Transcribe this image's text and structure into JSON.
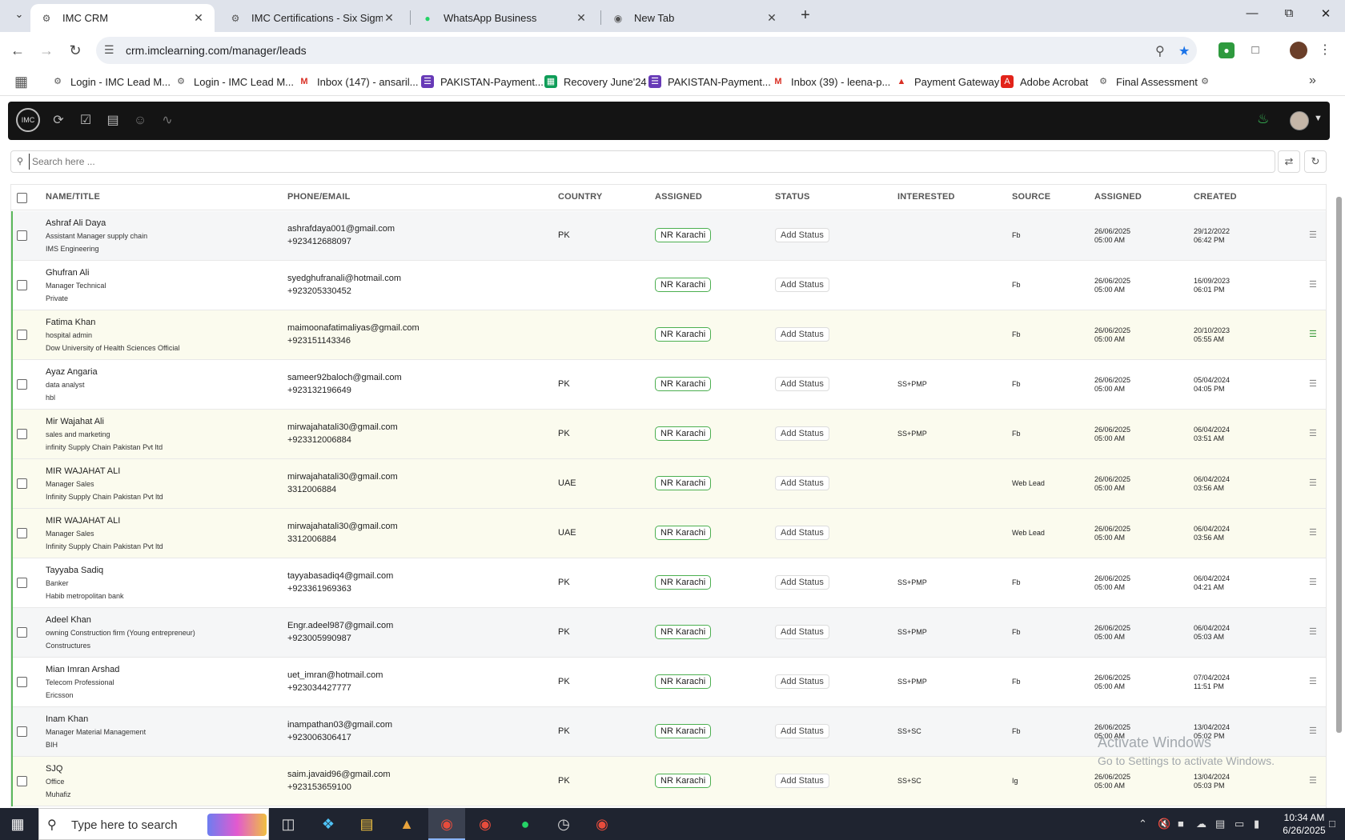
{
  "browser": {
    "tabs": [
      {
        "title": "IMC CRM",
        "active": true,
        "icon": "imc-logo-icon"
      },
      {
        "title": "IMC Certifications - Six Sigma G",
        "active": false,
        "icon": "imc-logo-icon"
      },
      {
        "title": "WhatsApp Business",
        "active": false,
        "icon": "whatsapp-icon"
      },
      {
        "title": "New Tab",
        "active": false,
        "icon": "chrome-icon"
      }
    ],
    "url": "crm.imclearning.com/manager/leads",
    "bookmarks": [
      {
        "label": "Login - IMC Lead M...",
        "icon": "imc-logo-icon"
      },
      {
        "label": "Login - IMC Lead M...",
        "icon": "imc-logo-icon"
      },
      {
        "label": "Inbox (147) - ansaril...",
        "icon": "gmail-icon"
      },
      {
        "label": "PAKISTAN-Payment...",
        "icon": "forms-icon"
      },
      {
        "label": "Recovery June'24",
        "icon": "sheets-icon"
      },
      {
        "label": "PAKISTAN-Payment...",
        "icon": "forms-icon"
      },
      {
        "label": "Inbox (39) - leena-p...",
        "icon": "gmail-icon"
      },
      {
        "label": "Payment Gateway",
        "icon": "payment-icon"
      },
      {
        "label": "Adobe Acrobat",
        "icon": "acrobat-icon"
      },
      {
        "label": "Final Assessment",
        "icon": "imc-logo-icon"
      }
    ]
  },
  "app": {
    "logo_text": "IMC",
    "search_placeholder": "Search here ...",
    "columns": {
      "name": "NAME/TITLE",
      "phone": "PHONE/EMAIL",
      "country": "COUNTRY",
      "assignee": "ASSIGNED",
      "status": "STATUS",
      "interested": "INTERESTED",
      "source": "SOURCE",
      "assigned": "ASSIGNED",
      "created": "CREATED"
    },
    "leads": [
      {
        "name": "Ashraf Ali Daya",
        "title": "Assistant Manager supply chain",
        "org": "IMS Engineering",
        "email": "ashrafdaya001@gmail.com",
        "phone": "+923412688097",
        "country": "PK",
        "assignee": "NR Karachi",
        "status": "Add Status",
        "interested": "",
        "source": "Fb",
        "assigned_date": "26/06/2025",
        "assigned_time": "05:00 AM",
        "created_date": "29/12/2022",
        "created_time": "06:42 PM",
        "color": "gray",
        "doc": "gray"
      },
      {
        "name": "Ghufran Ali",
        "title": "Manager Technical",
        "org": "Private",
        "email": "syedghufranali@hotmail.com",
        "phone": "+923205330452",
        "country": "",
        "assignee": "NR Karachi",
        "status": "Add Status",
        "interested": "",
        "source": "Fb",
        "assigned_date": "26/06/2025",
        "assigned_time": "05:00 AM",
        "created_date": "16/09/2023",
        "created_time": "06:01 PM",
        "color": "white",
        "doc": "gray"
      },
      {
        "name": "Fatima Khan",
        "title": "hospital admin",
        "org": "Dow University of Health Sciences Official",
        "email": "maimoonafatimaliyas@gmail.com",
        "phone": "+923151143346",
        "country": "",
        "assignee": "NR Karachi",
        "status": "Add Status",
        "interested": "",
        "source": "Fb",
        "assigned_date": "26/06/2025",
        "assigned_time": "05:00 AM",
        "created_date": "20/10/2023",
        "created_time": "05:55 AM",
        "color": "yellow",
        "doc": "green"
      },
      {
        "name": "Ayaz Angaria",
        "title": "data analyst",
        "org": "hbl",
        "email": "sameer92baloch@gmail.com",
        "phone": "+923132196649",
        "country": "PK",
        "assignee": "NR Karachi",
        "status": "Add Status",
        "interested": "SS+PMP",
        "source": "Fb",
        "assigned_date": "26/06/2025",
        "assigned_time": "05:00 AM",
        "created_date": "05/04/2024",
        "created_time": "04:05 PM",
        "color": "white",
        "doc": "gray"
      },
      {
        "name": "Mir Wajahat Ali",
        "title": "sales and marketing",
        "org": "infinity Supply Chain Pakistan Pvt ltd",
        "email": "mirwajahatali30@gmail.com",
        "phone": "+923312006884",
        "country": "PK",
        "assignee": "NR Karachi",
        "status": "Add Status",
        "interested": "SS+PMP",
        "source": "Fb",
        "assigned_date": "26/06/2025",
        "assigned_time": "05:00 AM",
        "created_date": "06/04/2024",
        "created_time": "03:51 AM",
        "color": "yellow",
        "doc": "gray"
      },
      {
        "name": "MIR WAJAHAT ALI",
        "title": "Manager Sales",
        "org": "Infinity Supply Chain Pakistan Pvt ltd",
        "email": "mirwajahatali30@gmail.com",
        "phone": "3312006884",
        "country": "UAE",
        "assignee": "NR Karachi",
        "status": "Add Status",
        "interested": "",
        "source": "Web Lead",
        "assigned_date": "26/06/2025",
        "assigned_time": "05:00 AM",
        "created_date": "06/04/2024",
        "created_time": "03:56 AM",
        "color": "yellow",
        "doc": "gray"
      },
      {
        "name": "MIR WAJAHAT ALI",
        "title": "Manager Sales",
        "org": "Infinity Supply Chain Pakistan Pvt ltd",
        "email": "mirwajahatali30@gmail.com",
        "phone": "3312006884",
        "country": "UAE",
        "assignee": "NR Karachi",
        "status": "Add Status",
        "interested": "",
        "source": "Web Lead",
        "assigned_date": "26/06/2025",
        "assigned_time": "05:00 AM",
        "created_date": "06/04/2024",
        "created_time": "03:56 AM",
        "color": "yellow",
        "doc": "gray"
      },
      {
        "name": "Tayyaba Sadiq",
        "title": "Banker",
        "org": "Habib metropolitan bank",
        "email": "tayyabasadiq4@gmail.com",
        "phone": "+923361969363",
        "country": "PK",
        "assignee": "NR Karachi",
        "status": "Add Status",
        "interested": "SS+PMP",
        "source": "Fb",
        "assigned_date": "26/06/2025",
        "assigned_time": "05:00 AM",
        "created_date": "06/04/2024",
        "created_time": "04:21 AM",
        "color": "white",
        "doc": "gray"
      },
      {
        "name": "Adeel Khan",
        "title": "owning Construction firm (Young entrepreneur)",
        "org": "Constructures",
        "email": "Engr.adeel987@gmail.com",
        "phone": "+923005990987",
        "country": "PK",
        "assignee": "NR Karachi",
        "status": "Add Status",
        "interested": "SS+PMP",
        "source": "Fb",
        "assigned_date": "26/06/2025",
        "assigned_time": "05:00 AM",
        "created_date": "06/04/2024",
        "created_time": "05:03 AM",
        "color": "gray",
        "doc": "gray"
      },
      {
        "name": "Mian Imran Arshad",
        "title": "Telecom Professional",
        "org": "Ericsson",
        "email": "uet_imran@hotmail.com",
        "phone": "+923034427777",
        "country": "PK",
        "assignee": "NR Karachi",
        "status": "Add Status",
        "interested": "SS+PMP",
        "source": "Fb",
        "assigned_date": "26/06/2025",
        "assigned_time": "05:00 AM",
        "created_date": "07/04/2024",
        "created_time": "11:51 PM",
        "color": "white",
        "doc": "gray"
      },
      {
        "name": "Inam Khan",
        "title": "Manager Material Management",
        "org": "BIH",
        "email": "inampathan03@gmail.com",
        "phone": "+923006306417",
        "country": "PK",
        "assignee": "NR Karachi",
        "status": "Add Status",
        "interested": "SS+SC",
        "source": "Fb",
        "assigned_date": "26/06/2025",
        "assigned_time": "05:00 AM",
        "created_date": "13/04/2024",
        "created_time": "05:02 PM",
        "color": "gray",
        "doc": "gray"
      },
      {
        "name": "SJQ",
        "title": "Office",
        "org": "Muhafiz",
        "email": "saim.javaid96@gmail.com",
        "phone": "+923153659100",
        "country": "PK",
        "assignee": "NR Karachi",
        "status": "Add Status",
        "interested": "SS+SC",
        "source": "Ig",
        "assigned_date": "26/06/2025",
        "assigned_time": "05:00 AM",
        "created_date": "13/04/2024",
        "created_time": "05:03 PM",
        "color": "yellow",
        "doc": "gray"
      }
    ]
  },
  "watermark": {
    "line1": "Activate Windows",
    "line2": "Go to Settings to activate Windows."
  },
  "taskbar": {
    "search_placeholder": "Type here to search",
    "time": "10:34 AM",
    "date": "6/26/2025"
  },
  "colors": {
    "accent_green": "#4caf50",
    "header_bg": "#141414",
    "row_yellow": "#fbfbee",
    "row_gray": "#f5f6f7"
  }
}
